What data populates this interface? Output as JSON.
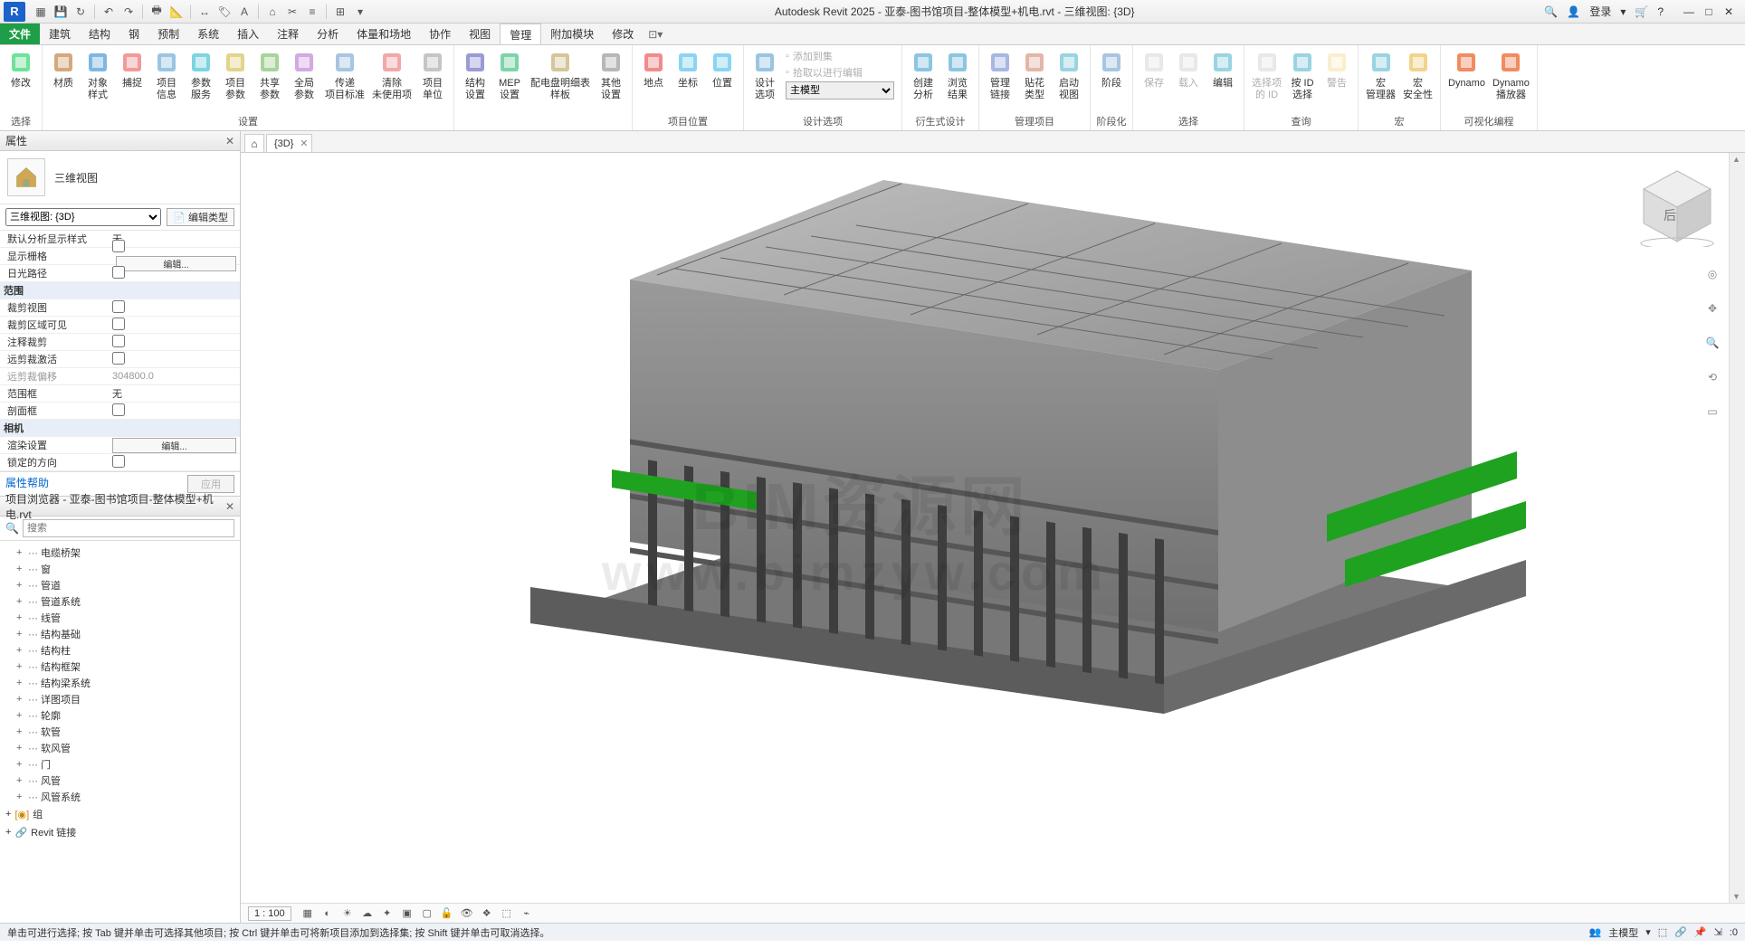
{
  "title": "Autodesk Revit 2025 - 亚泰-图书馆项目-整体模型+机电.rvt - 三维视图: {3D}",
  "login": "登录",
  "menu": {
    "file": "文件",
    "items": [
      "建筑",
      "结构",
      "钢",
      "预制",
      "系统",
      "插入",
      "注释",
      "分析",
      "体量和场地",
      "协作",
      "视图",
      "管理",
      "附加模块",
      "修改"
    ],
    "active": "管理"
  },
  "ribbon": {
    "groups": [
      {
        "title": "选择",
        "big": [
          {
            "l": "修改",
            "ico": "cursor"
          }
        ]
      },
      {
        "title": "设置",
        "big": [
          {
            "l": "材质",
            "ico": "sphere"
          },
          {
            "l": "对象\n样式",
            "ico": "obj"
          },
          {
            "l": "捕捉",
            "ico": "snap"
          },
          {
            "l": "项目\n信息",
            "ico": "doc"
          },
          {
            "l": "参数\n服务",
            "ico": "cloud"
          },
          {
            "l": "项目\n参数",
            "ico": "pparam"
          },
          {
            "l": "共享\n参数",
            "ico": "sparam"
          },
          {
            "l": "全局\n参数",
            "ico": "gparam"
          },
          {
            "l": "传递\n项目标准",
            "ico": "trans"
          },
          {
            "l": "清除\n未使用项",
            "ico": "purge"
          },
          {
            "l": "项目\n单位",
            "ico": "unit"
          }
        ]
      },
      {
        "title": "",
        "big": [
          {
            "l": "结构\n设置",
            "ico": "struct"
          },
          {
            "l": "MEP\n设置",
            "ico": "mep"
          },
          {
            "l": "配电盘明细表\n样板",
            "ico": "panel"
          },
          {
            "l": "其他\n设置",
            "ico": "other"
          }
        ]
      },
      {
        "title": "项目位置",
        "big": [
          {
            "l": "地点",
            "ico": "loc"
          },
          {
            "l": "坐标",
            "ico": "coord"
          },
          {
            "l": "位置",
            "ico": "pos"
          }
        ]
      },
      {
        "title": "设计选项",
        "big": [
          {
            "l": "设计\n选项",
            "ico": "dopt"
          }
        ],
        "side": [
          {
            "l": "添加到集",
            "d": true
          },
          {
            "l": "拾取以进行编辑",
            "d": true
          },
          {
            "l": "主模型",
            "sel": true
          }
        ]
      },
      {
        "title": "衍生式设计",
        "big": [
          {
            "l": "创建\n分析",
            "ico": "gen1"
          },
          {
            "l": "浏览\n结果",
            "ico": "gen2"
          }
        ]
      },
      {
        "title": "管理项目",
        "big": [
          {
            "l": "管理\n链接",
            "ico": "mlink"
          },
          {
            "l": "贴花\n类型",
            "ico": "decal"
          },
          {
            "l": "启动\n视图",
            "ico": "sview"
          }
        ]
      },
      {
        "title": "阶段化",
        "big": [
          {
            "l": "阶段",
            "ico": "phase"
          }
        ]
      },
      {
        "title": "选择",
        "big": [
          {
            "l": "保存",
            "ico": "save",
            "d": true
          },
          {
            "l": "载入",
            "ico": "load",
            "d": true
          },
          {
            "l": "编辑",
            "ico": "edit"
          }
        ]
      },
      {
        "title": "查询",
        "big": [
          {
            "l": "选择项\n的 ID",
            "ico": "id1",
            "d": true
          },
          {
            "l": "按 ID\n选择",
            "ico": "id2"
          },
          {
            "l": "警告",
            "ico": "warn",
            "d": true
          }
        ]
      },
      {
        "title": "宏",
        "big": [
          {
            "l": "宏\n管理器",
            "ico": "macro1"
          },
          {
            "l": "宏\n安全性",
            "ico": "macro2"
          }
        ]
      },
      {
        "title": "可视化编程",
        "big": [
          {
            "l": "Dynamo",
            "ico": "dyn"
          },
          {
            "l": "Dynamo\n播放器",
            "ico": "dynp"
          }
        ]
      }
    ]
  },
  "properties": {
    "header": "属性",
    "type": "三维视图",
    "instance": "三维视图: {3D}",
    "editType": "编辑类型",
    "rows": [
      {
        "k": "默认分析显示样式",
        "v": "无"
      },
      {
        "k": "显示栅格",
        "cb": false,
        "ed": "编辑..."
      },
      {
        "k": "日光路径",
        "cb": false
      },
      {
        "cat": "范围"
      },
      {
        "k": "裁剪视图",
        "cb": false
      },
      {
        "k": "裁剪区域可见",
        "cb": false
      },
      {
        "k": "注释裁剪",
        "cb": false
      },
      {
        "k": "远剪裁激活",
        "cb": false
      },
      {
        "k": "远剪裁偏移",
        "v": "304800.0",
        "dim": true
      },
      {
        "k": "范围框",
        "v": "无"
      },
      {
        "k": "剖面框",
        "cb": false
      },
      {
        "cat": "相机"
      },
      {
        "k": "渲染设置",
        "ed": "编辑..."
      },
      {
        "k": "锁定的方向",
        "cb": false
      }
    ],
    "help": "属性帮助",
    "apply": "应用"
  },
  "browser": {
    "header": "项目浏览器 - 亚泰-图书馆项目-整体模型+机电.rvt",
    "search": "搜索",
    "items": [
      "电缆桥架",
      "窗",
      "管道",
      "管道系统",
      "线管",
      "结构基础",
      "结构柱",
      "结构框架",
      "结构梁系统",
      "详图项目",
      "轮廓",
      "软管",
      "软风管",
      "门",
      "风管",
      "风管系统"
    ],
    "group": "组",
    "link": "Revit 链接"
  },
  "view": {
    "tab": "{3D}",
    "scale": "1 : 100"
  },
  "status": "单击可进行选择; 按 Tab 键并单击可选择其他项目; 按 Ctrl 键并单击可将新项目添加到选择集; 按 Shift 键并单击可取消选择。",
  "status_right": {
    "model": "主模型"
  }
}
